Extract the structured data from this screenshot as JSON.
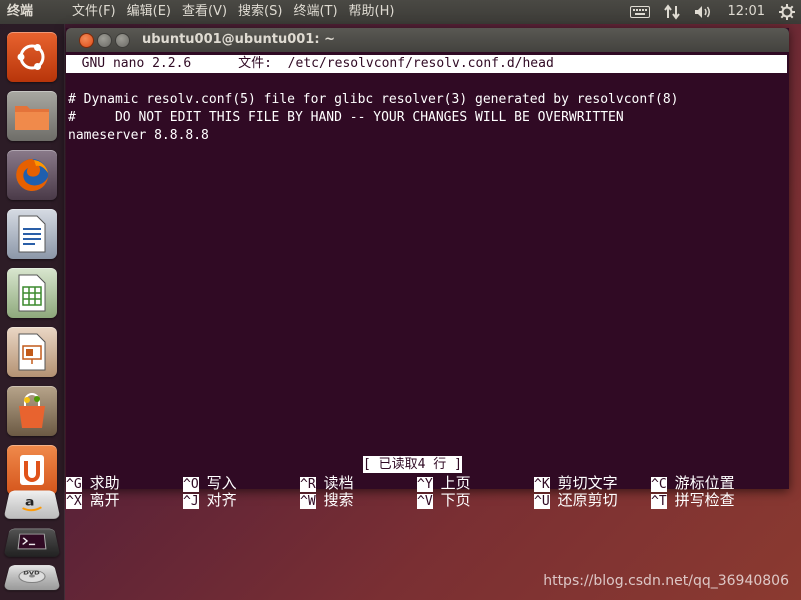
{
  "top_panel": {
    "app_title": "终端",
    "menus": [
      "文件(F)",
      "编辑(E)",
      "查看(V)",
      "搜索(S)",
      "终端(T)",
      "帮助(H)"
    ],
    "clock": "12:01",
    "indicators": [
      "keyboard-icon",
      "network-icon",
      "volume-icon",
      "gear-icon"
    ]
  },
  "launcher": {
    "items": [
      "ubuntu-dash-icon",
      "files-icon",
      "firefox-icon",
      "libreoffice-writer-icon",
      "libreoffice-calc-icon",
      "libreoffice-impress-icon",
      "software-center-icon",
      "ubuntu-one-icon",
      "amazon-icon",
      "terminal-icon",
      "dvd-icon"
    ]
  },
  "window": {
    "title": "ubuntu001@ubuntu001: ~"
  },
  "nano": {
    "header": "  GNU nano 2.2.6      文件:  /etc/resolvconf/resolv.conf.d/head",
    "content": [
      "# Dynamic resolv.conf(5) file for glibc resolver(3) generated by resolvconf(8)",
      "#     DO NOT EDIT THIS FILE BY HAND -- YOUR CHANGES WILL BE OVERWRITTEN",
      "nameserver 8.8.8.8"
    ],
    "status": "[ 已读取4 行 ]",
    "shortcuts_row1": [
      {
        "key": "^G",
        "label": "求助"
      },
      {
        "key": "^O",
        "label": "写入"
      },
      {
        "key": "^R",
        "label": "读档"
      },
      {
        "key": "^Y",
        "label": "上页"
      },
      {
        "key": "^K",
        "label": "剪切文字"
      },
      {
        "key": "^C",
        "label": "游标位置"
      }
    ],
    "shortcuts_row2": [
      {
        "key": "^X",
        "label": "离开"
      },
      {
        "key": "^J",
        "label": "对齐"
      },
      {
        "key": "^W",
        "label": "搜索"
      },
      {
        "key": "^V",
        "label": "下页"
      },
      {
        "key": "^U",
        "label": "还原剪切"
      },
      {
        "key": "^T",
        "label": "拼写检查"
      }
    ]
  },
  "watermark": "https://blog.csdn.net/qq_36940806",
  "colors": {
    "terminal_bg": "#300a24",
    "accent": "#dd4814"
  }
}
